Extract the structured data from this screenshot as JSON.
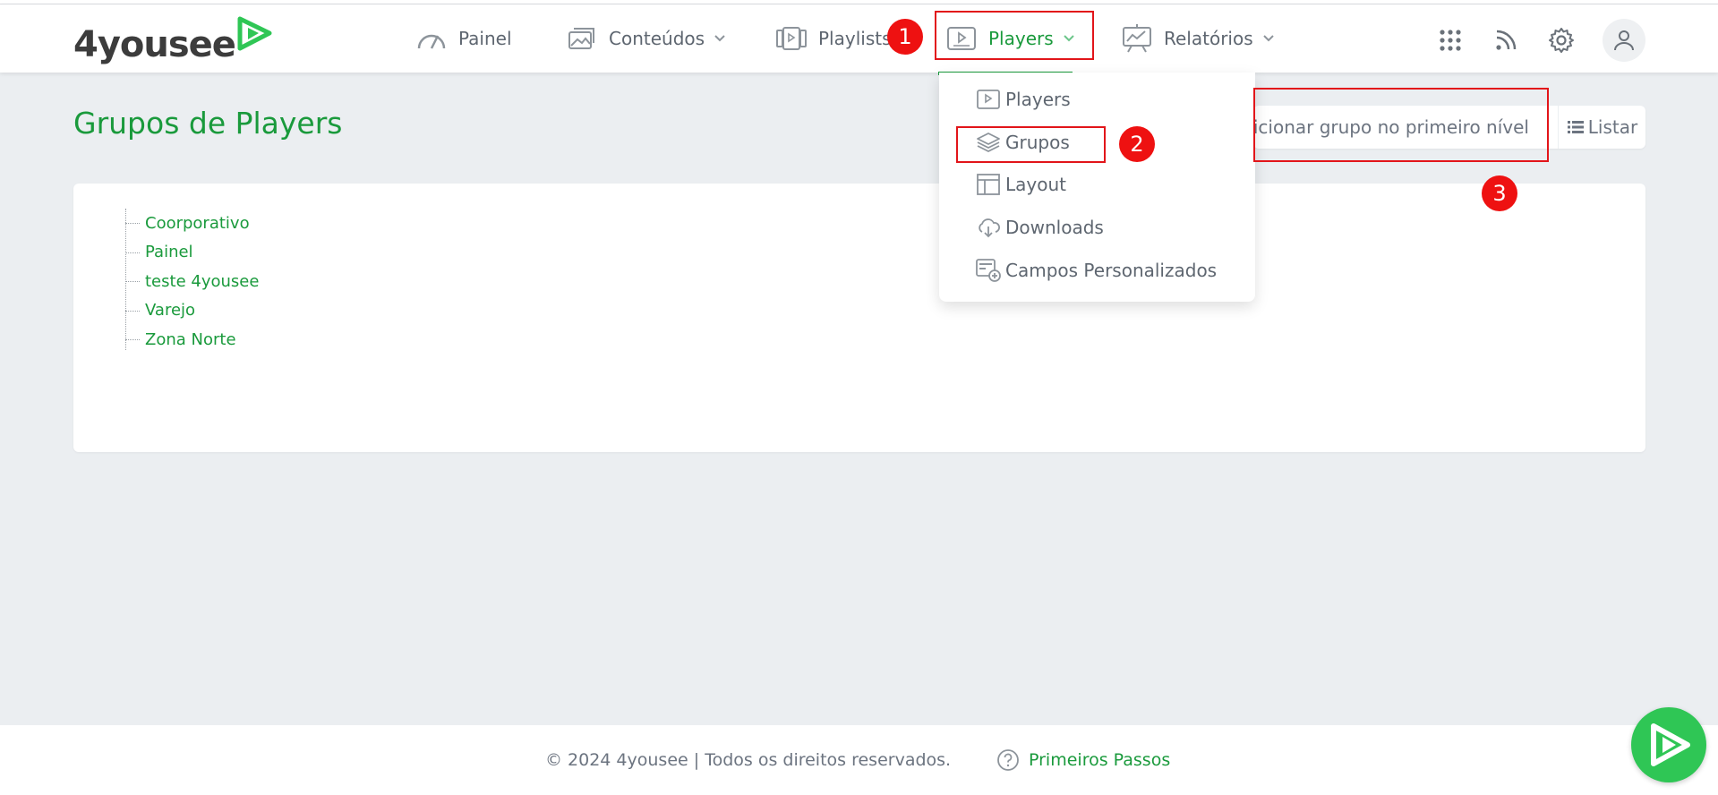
{
  "brand": {
    "name": "4yousee",
    "color": "#1a9a3c"
  },
  "nav": {
    "painel": {
      "label": "Painel",
      "icon": "speedometer-icon"
    },
    "conteudos": {
      "label": "Conteúdos",
      "icon": "image-stack-icon"
    },
    "playlists": {
      "label": "Playlists",
      "icon": "playlist-icon"
    },
    "players": {
      "label": "Players",
      "icon": "player-screen-icon"
    },
    "relatorios": {
      "label": "Relatórios",
      "icon": "chart-board-icon"
    }
  },
  "header_icons": [
    "apps-grid-icon",
    "rss-feed-icon",
    "gear-icon",
    "user-icon"
  ],
  "annotations": {
    "marker_1": "1",
    "marker_2": "2",
    "marker_3": "3"
  },
  "page": {
    "title": "Grupos de Players",
    "add_group_label": "Adicionar grupo no primeiro nível",
    "list_button": "Listar"
  },
  "players_menu": [
    {
      "label": "Players",
      "icon": "player-screen-icon"
    },
    {
      "label": "Grupos",
      "icon": "layers-icon"
    },
    {
      "label": "Layout",
      "icon": "layout-icon"
    },
    {
      "label": "Downloads",
      "icon": "cloud-download-icon"
    },
    {
      "label": "Campos Personalizados",
      "icon": "custom-fields-icon"
    }
  ],
  "groups": [
    "Coorporativo",
    "Painel",
    "teste 4yousee",
    "Varejo",
    "Zona Norte"
  ],
  "footer": {
    "copyright": "© 2024 4yousee | Todos os direitos reservados.",
    "first_steps": "Primeiros Passos"
  }
}
